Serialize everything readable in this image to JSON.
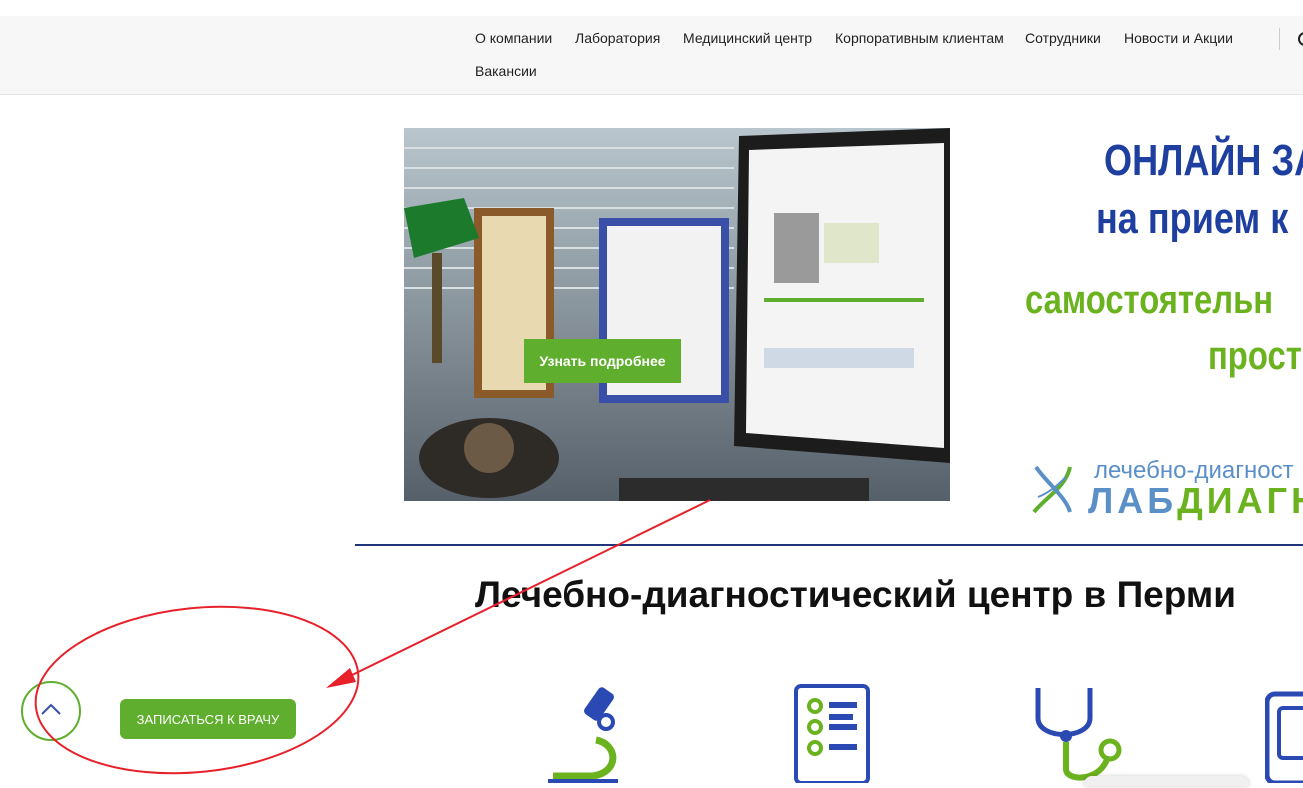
{
  "nav": {
    "items": [
      "О компании",
      "Лаборатория",
      "Медицинский центр",
      "Корпоративным клиентам",
      "Сотрудники",
      "Новости и Акции",
      "Вакансии"
    ]
  },
  "hero": {
    "button_label": "Узнать подробнее",
    "promo_line1": "ОНЛАЙН ЗА",
    "promo_line2": "на прием к",
    "promo_line3": "самостоятельн",
    "promo_line4": "прост",
    "logo_small": "лечебно-диагност",
    "logo_big_a": "ЛАБ",
    "logo_big_b": "ДИАГН"
  },
  "section": {
    "title": "Лечебно-диагностический центр в Перми"
  },
  "features": {
    "icons": [
      "microscope-icon",
      "checklist-icon",
      "stethoscope-icon",
      "device-icon"
    ]
  },
  "cta": {
    "label": "ЗАПИСАТЬСЯ К ВРАЧУ"
  },
  "colors": {
    "accent_green": "#5fae2e",
    "brand_blue": "#1f3fa0",
    "annotation_red": "#e8202a"
  }
}
